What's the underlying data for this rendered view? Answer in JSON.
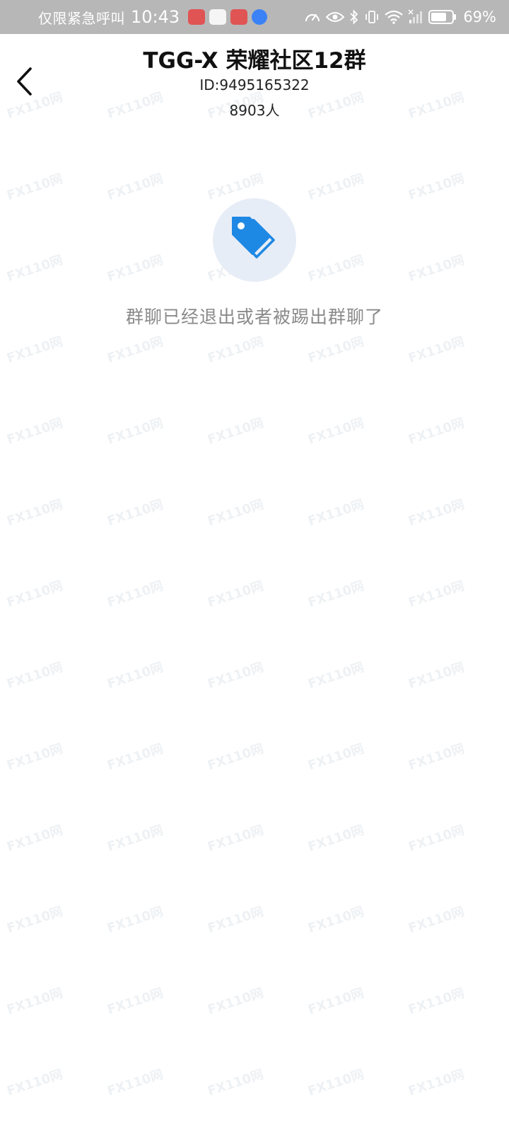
{
  "status_bar": {
    "carrier_text": "仅限紧急呼叫",
    "time": "10:43",
    "battery_percent": "69%"
  },
  "header": {
    "title": "TGG-X 荣耀社区12群",
    "group_id": "ID:9495165322",
    "member_count": "8903人"
  },
  "empty_state": {
    "icon": "tag-icon",
    "message": "群聊已经退出或者被踢出群聊了",
    "accent_color": "#1e88e5"
  },
  "watermark": {
    "text": "FX110网"
  }
}
